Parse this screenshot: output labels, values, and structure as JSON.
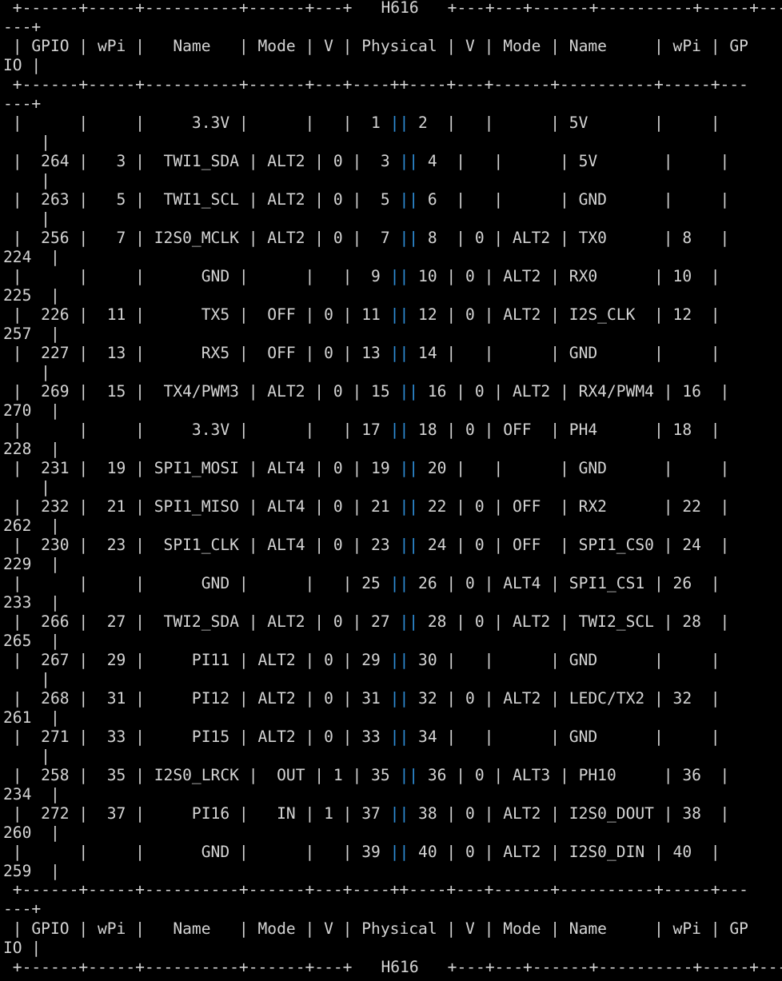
{
  "terminal": {
    "board_name": "H616",
    "border_top": " +------+-----+----------+------+---+",
    "border_top_right": "+---+---+------+----------+-----+---",
    "border_top_wrap": "---+",
    "header_line1": " | GPIO | wPi |   Name   | Mode | V | Physical | V | Mode | Name     | wPi | GP",
    "header_line2": "IO |",
    "separator_line1": " +------+-----+----------+------+---+----++----+---+------+----------+-----+---",
    "separator_line2": "---+",
    "colors": {
      "background": "#000000",
      "text": "#d4d4d4",
      "center_pipe": "#2f8fd8"
    },
    "rows": [
      {
        "left": " |      |     |     3.3V |      |   |  1 ",
        "right": " 2  |   |      | 5V       |     |",
        "wrap": "    |"
      },
      {
        "left": " |  264 |   3 |  TWI1_SDA | ALT2 | 0 |  3 ",
        "right": " 4  |   |      | 5V       |     |",
        "wrap": "    |"
      },
      {
        "left": " |  263 |   5 |  TWI1_SCL | ALT2 | 0 |  5 ",
        "right": " 6  |   |      | GND      |     |",
        "wrap": "    |"
      },
      {
        "left": " |  256 |   7 | I2S0_MCLK | ALT2 | 0 |  7 ",
        "right": " 8  | 0 | ALT2 | TX0      | 8   |",
        "wrap": "224  |"
      },
      {
        "left": " |      |     |      GND |      |   |  9 ",
        "right": " 10 | 0 | ALT2 | RX0      | 10  |",
        "wrap": "225  |"
      },
      {
        "left": " |  226 |  11 |      TX5 |  OFF | 0 | 11 ",
        "right": " 12 | 0 | ALT2 | I2S_CLK  | 12  |",
        "wrap": "257  |"
      },
      {
        "left": " |  227 |  13 |      RX5 |  OFF | 0 | 13 ",
        "right": " 14 |   |      | GND      |     |",
        "wrap": "    |"
      },
      {
        "left": " |  269 |  15 |  TX4/PWM3 | ALT2 | 0 | 15 ",
        "right": " 16 | 0 | ALT2 | RX4/PWM4 | 16  |",
        "wrap": "270  |"
      },
      {
        "left": " |      |     |     3.3V |      |   | 17 ",
        "right": " 18 | 0 | OFF  | PH4      | 18  |",
        "wrap": "228  |"
      },
      {
        "left": " |  231 |  19 | SPI1_MOSI | ALT4 | 0 | 19 ",
        "right": " 20 |   |      | GND      |     |",
        "wrap": "    |"
      },
      {
        "left": " |  232 |  21 | SPI1_MISO | ALT4 | 0 | 21 ",
        "right": " 22 | 0 | OFF  | RX2      | 22  |",
        "wrap": "262  |"
      },
      {
        "left": " |  230 |  23 |  SPI1_CLK | ALT4 | 0 | 23 ",
        "right": " 24 | 0 | OFF  | SPI1_CS0 | 24  |",
        "wrap": "229  |"
      },
      {
        "left": " |      |     |      GND |      |   | 25 ",
        "right": " 26 | 0 | ALT4 | SPI1_CS1 | 26  |",
        "wrap": "233  |"
      },
      {
        "left": " |  266 |  27 |  TWI2_SDA | ALT2 | 0 | 27 ",
        "right": " 28 | 0 | ALT2 | TWI2_SCL | 28  |",
        "wrap": "265  |"
      },
      {
        "left": " |  267 |  29 |     PI11 | ALT2 | 0 | 29 ",
        "right": " 30 |   |      | GND      |     |",
        "wrap": "    |"
      },
      {
        "left": " |  268 |  31 |     PI12 | ALT2 | 0 | 31 ",
        "right": " 32 | 0 | ALT2 | LEDC/TX2 | 32  |",
        "wrap": "261  |"
      },
      {
        "left": " |  271 |  33 |     PI15 | ALT2 | 0 | 33 ",
        "right": " 34 |   |      | GND      |     |",
        "wrap": "    |"
      },
      {
        "left": " |  258 |  35 | I2S0_LRCK |  OUT | 1 | 35 ",
        "right": " 36 | 0 | ALT3 | PH10     | 36  |",
        "wrap": "234  |"
      },
      {
        "left": " |  272 |  37 |     PI16 |   IN | 1 | 37 ",
        "right": " 38 | 0 | ALT2 | I2S0_DOUT | 38  |",
        "wrap": "260  |"
      },
      {
        "left": " |      |     |      GND |      |   | 39 ",
        "right": " 40 | 0 | ALT2 | I2S0_DIN | 40  |",
        "wrap": "259  |"
      }
    ],
    "center_pipe": "||"
  }
}
